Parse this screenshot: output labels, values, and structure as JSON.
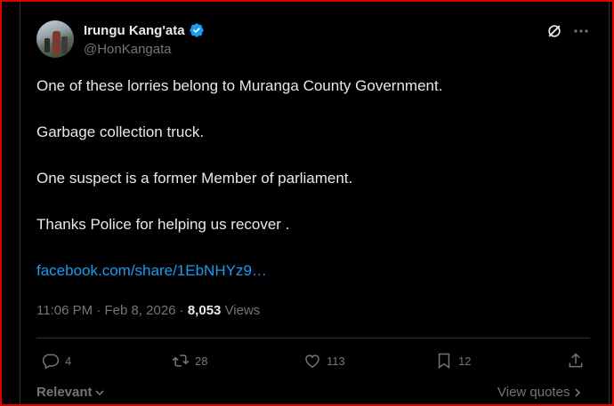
{
  "author": {
    "name": "Irungu Kang'ata",
    "handle": "@HonKangata",
    "verified": true,
    "verified_color": "#1d9bf0"
  },
  "post": {
    "lines": [
      "One of these lorries belong to Muranga County Government.",
      "Garbage collection truck.",
      "One suspect is a former Member of parliament.",
      "Thanks Police for helping us recover ."
    ],
    "link": "facebook.com/share/1EbNHYz9…",
    "time": "11:06 PM",
    "separator": "·",
    "date": "Feb 8, 2026",
    "views_count": "8,053",
    "views_label": "Views"
  },
  "actions": {
    "replies": "4",
    "reposts": "28",
    "likes": "113",
    "bookmarks": "12"
  },
  "footer": {
    "sort_label": "Relevant",
    "view_quotes_label": "View quotes"
  },
  "icons": [
    "grok-icon",
    "more-icon",
    "verified-badge-icon",
    "reply-icon",
    "repost-icon",
    "like-icon",
    "bookmark-icon",
    "share-icon",
    "chevron-down-icon",
    "chevron-right-icon"
  ],
  "colors": {
    "background": "#000000",
    "text": "#e7e9ea",
    "muted": "#71767b",
    "link": "#1d9bf0",
    "border": "#2f3336"
  }
}
